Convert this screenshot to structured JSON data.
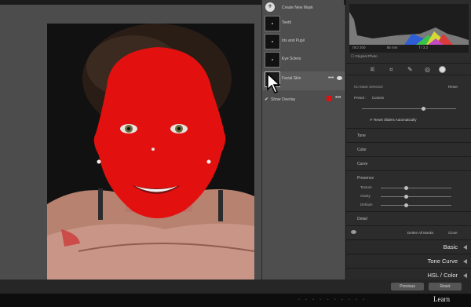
{
  "masks": {
    "create_label": "Create New Mask",
    "items": [
      {
        "label": "Teeth"
      },
      {
        "label": "Iris and Pupil"
      },
      {
        "label": "Eye Sclera"
      },
      {
        "label": "Facial Skin"
      }
    ],
    "show_overlay": "Show Overlay",
    "overlay_color": "#e01010"
  },
  "histogram": {
    "iso": "ISO 200",
    "focal": "85 mm",
    "aperture": "f / 3.2",
    "original_photo": "Original Photo"
  },
  "mask_panel": {
    "name": "No Mask Selected",
    "reset": "Reset",
    "preset_label": "Preset :",
    "preset_value": "Custom",
    "reset_sliders": "Reset Sliders Automatically"
  },
  "sections": {
    "tone": "Tone",
    "color": "Color",
    "curve": "Curve",
    "presence": "Presence",
    "texture": "Texture",
    "clarity": "Clarity",
    "dehaze": "Dehaze",
    "detail": "Detail",
    "delete_all": "Delete All Masks",
    "close": "Close"
  },
  "panels": {
    "basic": "Basic",
    "tone_curve": "Tone Curve",
    "hsl": "HSL / Color"
  },
  "footer": {
    "previous": "Previous",
    "reset": "Reset",
    "learn": "Learn"
  },
  "colors": {
    "accent": "#d61c1c"
  }
}
